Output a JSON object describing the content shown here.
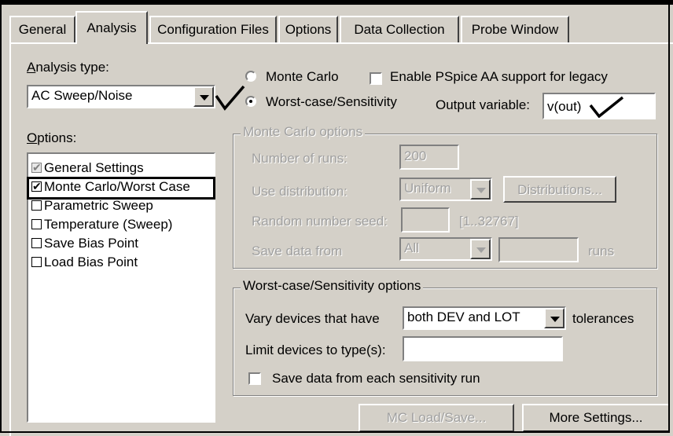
{
  "tabs": [
    {
      "label": "General",
      "active": false
    },
    {
      "label": "Analysis",
      "active": true
    },
    {
      "label": "Configuration Files",
      "active": false
    },
    {
      "label": "Options",
      "active": false
    },
    {
      "label": "Data Collection",
      "active": false
    },
    {
      "label": "Probe Window",
      "active": false
    }
  ],
  "analysis_type": {
    "label_underlined": "A",
    "label_rest": "nalysis type:",
    "value": "AC Sweep/Noise"
  },
  "options": {
    "label_underlined": "O",
    "label_rest": "ptions:",
    "items": [
      {
        "label": "General Settings",
        "checked": true,
        "disabled": true
      },
      {
        "label": "Monte Carlo/Worst Case",
        "checked": true,
        "selected": true
      },
      {
        "label": "Parametric Sweep",
        "checked": false
      },
      {
        "label": "Temperature (Sweep)",
        "checked": false
      },
      {
        "label": "Save Bias Point",
        "checked": false
      },
      {
        "label": "Load Bias Point",
        "checked": false
      }
    ]
  },
  "mode": {
    "monte_carlo_label": "Monte Carlo",
    "worst_case_label": "Worst-case/Sensitivity",
    "selected": "worst_case"
  },
  "pspice_aa": {
    "label": "Enable PSpice AA support for legacy",
    "checked": false
  },
  "output_variable": {
    "label": "Output variable:",
    "value": "v(out)"
  },
  "monte_carlo_options": {
    "title": "Monte Carlo options",
    "runs_label": "Number of runs:",
    "runs_value": "200",
    "distribution_label": "Use distribution:",
    "distribution_value": "Uniform",
    "distributions_button": "Distributions...",
    "seed_label": "Random number seed:",
    "seed_range": "[1..32767]",
    "save_label": "Save data from",
    "save_value": "All",
    "runs_suffix": "runs"
  },
  "worst_case_options": {
    "title": "Worst-case/Sensitivity options",
    "vary_label": "Vary devices that have",
    "vary_value": "both DEV and LOT",
    "tolerances_label": "tolerances",
    "limit_label": "Limit devices to type(s):",
    "limit_value": "",
    "save_each_label": "Save data from each sensitivity run",
    "save_each_checked": false
  },
  "buttons": {
    "mc_load_save": "MC Load/Save...",
    "more_settings": "More Settings..."
  }
}
